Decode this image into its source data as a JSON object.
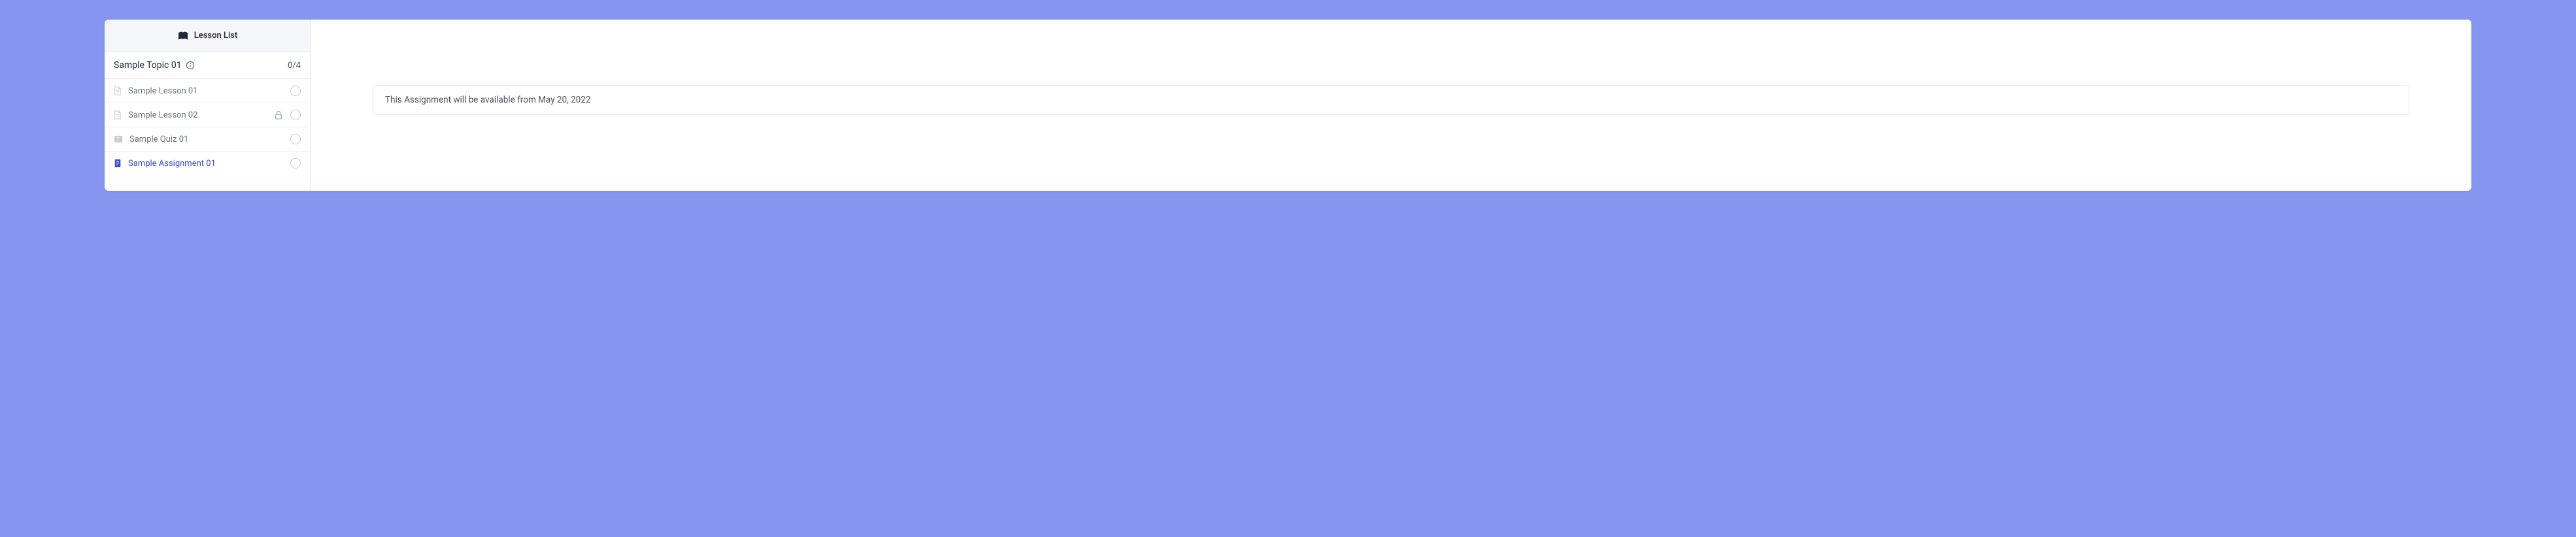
{
  "sidebar": {
    "header_title": "Lesson List",
    "topic": {
      "title": "Sample Topic 01",
      "progress": "0/4"
    },
    "items": [
      {
        "label": "Sample Lesson 01",
        "type": "lesson",
        "locked": false,
        "active": false
      },
      {
        "label": "Sample Lesson 02",
        "type": "lesson",
        "locked": true,
        "active": false
      },
      {
        "label": "Sample Quiz 01",
        "type": "quiz",
        "locked": false,
        "active": false
      },
      {
        "label": "Sample Assignment 01",
        "type": "assignment",
        "locked": false,
        "active": true
      }
    ]
  },
  "main": {
    "notice_text": "This Assignment will be available from May 20, 2022"
  }
}
